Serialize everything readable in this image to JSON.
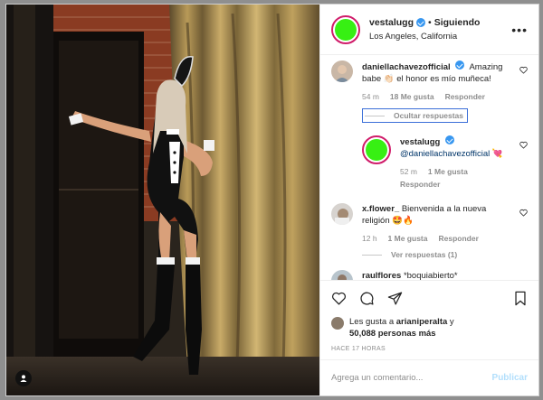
{
  "post": {
    "username": "vestalugg",
    "separator": "•",
    "follow_state": "Siguiendo",
    "location": "Los Angeles, California",
    "more_label": "•••",
    "avatar_color": "#37f013"
  },
  "comments": [
    {
      "username": "daniellachavezofficial",
      "text": "Amazing babe 👏🏻 el honor es mío muñeca!",
      "time": "54 m",
      "likes": "18 Me gusta",
      "reply": "Responder",
      "thread_toggle": "Ocultar respuestas"
    },
    {
      "username": "x.flower_",
      "text": "Bienvenida a la nueva religión 🤩🔥",
      "time": "12 h",
      "likes": "1 Me gusta",
      "reply": "Responder",
      "thread_toggle": "Ver respuestas (1)"
    },
    {
      "username": "raulflores",
      "text": "*boquiabierto*"
    }
  ],
  "replies": [
    {
      "username": "vestalugg",
      "mention": "@daniellachavezofficial",
      "emoji": "💘",
      "time": "52 m",
      "likes": "1 Me gusta",
      "reply": "Responder"
    }
  ],
  "likes_line": {
    "prefix": "Les gusta a ",
    "name": "arianiperalta",
    "middle": " y",
    "count": "50,088 personas más"
  },
  "time_ago": "HACE 17 HORAS",
  "composer": {
    "placeholder": "Agrega un comentario...",
    "publish": "Publicar"
  },
  "colors": {
    "story_ring": "#d01c6a",
    "verified": "#3897f0",
    "selection": "#3b6fd8"
  },
  "icons": [
    "heart-icon",
    "comment-icon",
    "share-icon",
    "bookmark-icon",
    "verified-icon",
    "user-tag-icon"
  ]
}
